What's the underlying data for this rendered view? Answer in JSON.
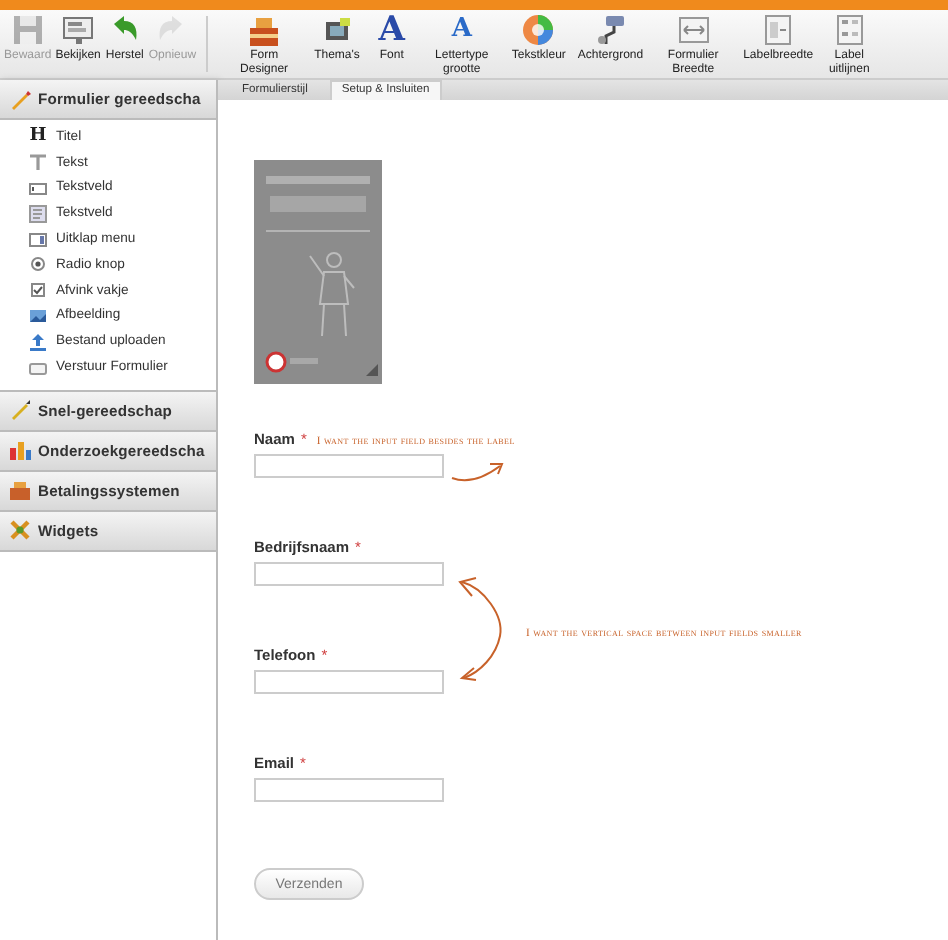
{
  "toolbar": [
    {
      "label": "Bewaard",
      "disabled": true
    },
    {
      "label": "Bekijken",
      "disabled": false
    },
    {
      "label": "Herstel",
      "disabled": false
    },
    {
      "label": "Opnieuw",
      "disabled": true
    },
    {
      "label": "Form Designer",
      "disabled": false
    },
    {
      "label": "Thema's",
      "disabled": false
    },
    {
      "label": "Font",
      "disabled": false,
      "glyph": "A"
    },
    {
      "label": "Lettertype grootte",
      "disabled": false,
      "glyph": "A"
    },
    {
      "label": "Tekstkleur",
      "disabled": false
    },
    {
      "label": "Achtergrond",
      "disabled": false
    },
    {
      "label": "Formulier Breedte",
      "disabled": false
    },
    {
      "label": "Labelbreedte",
      "disabled": false
    },
    {
      "label": "Label uitlijnen",
      "disabled": false
    }
  ],
  "sidebar": {
    "sections": [
      {
        "title": "Formulier gereedscha",
        "expanded": true,
        "items": [
          {
            "label": "Titel",
            "glyph": "H"
          },
          {
            "label": "Tekst"
          },
          {
            "label": "Tekstveld"
          },
          {
            "label": "Tekstveld"
          },
          {
            "label": "Uitklap menu"
          },
          {
            "label": "Radio knop"
          },
          {
            "label": "Afvink vakje"
          },
          {
            "label": "Afbeelding"
          },
          {
            "label": "Bestand uploaden"
          },
          {
            "label": "Verstuur Formulier"
          }
        ]
      },
      {
        "title": "Snel-gereedschap",
        "expanded": false
      },
      {
        "title": "Onderzoekgereedscha",
        "expanded": false
      },
      {
        "title": "Betalingssystemen",
        "expanded": false
      },
      {
        "title": "Widgets",
        "expanded": false
      }
    ]
  },
  "tabs": [
    {
      "label": "Formulierstijl",
      "selected": false
    },
    {
      "label": "Setup & Insluiten",
      "selected": true
    }
  ],
  "form": {
    "fields": [
      {
        "label": "Naam",
        "mark": "*",
        "note": "I want the input field besides the label"
      },
      {
        "label": "Bedrijfsnaam",
        "mark": "*"
      },
      {
        "label": "Telefoon",
        "mark": "*"
      },
      {
        "label": "Email",
        "mark": "*"
      }
    ],
    "annotation": "I want the vertical space between input fields smaller",
    "submit": "Verzenden"
  }
}
